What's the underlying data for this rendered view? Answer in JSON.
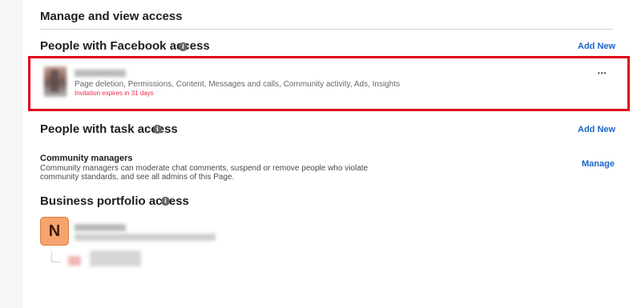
{
  "manage": {
    "title": "Manage and view access"
  },
  "facebook_access": {
    "title": "People with Facebook access",
    "add_new": "Add New",
    "person": {
      "permissions": "Page deletion, Permissions, Content, Messages and calls, Community activity, Ads, Insights",
      "invitation": "Invitation expires in 31 days",
      "more_menu": "•••"
    }
  },
  "task_access": {
    "title": "People with task access",
    "add_new": "Add New",
    "community": {
      "title": "Community managers",
      "description_line1": "Community managers can moderate chat comments, suspend or remove people who violate",
      "description_line2": "community standards, and see all admins of this Page.",
      "manage": "Manage"
    }
  },
  "business_access": {
    "title": "Business portfolio access",
    "avatar_letter": "N"
  },
  "info_icon_glyph": "i",
  "colors": {
    "link": "#1b64c9",
    "highlight_border": "#e0001b",
    "invitation_text": "#f02849",
    "business_avatar": "#f5a36f"
  }
}
